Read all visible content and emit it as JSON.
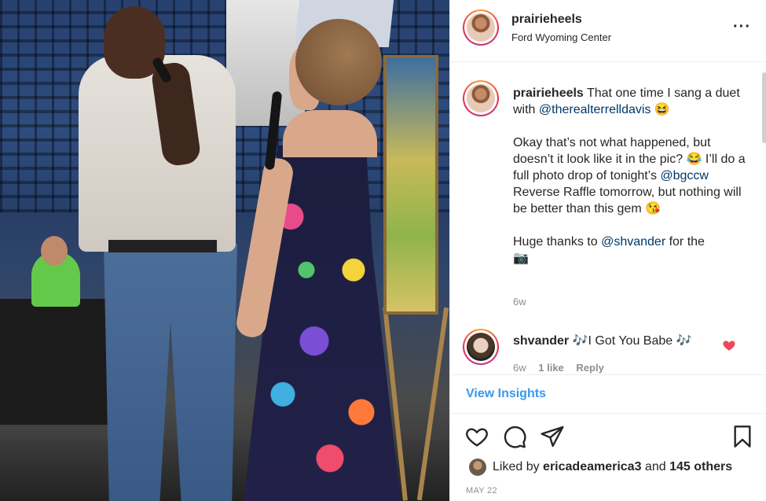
{
  "post": {
    "username": "prairieheels",
    "location": "Ford Wyoming Center",
    "more_icon": "more-horizontal-icon"
  },
  "caption": {
    "username": "prairieheels",
    "line1_text": " That one time I sang a duet with ",
    "mention1": "@therealterrelldavis",
    "emoji1": "😆",
    "para2_a": "Okay that’s not what happened, but doesn’t it look like it in the pic? ",
    "emoji2": "😂",
    "para2_b": " I’ll do a full photo drop of tonight’s ",
    "mention2": "@bgccw",
    "para2_c": " Reverse Raffle tomorrow, but nothing will be better than this gem ",
    "emoji3": "😘",
    "para3_a": "Huge thanks to ",
    "mention3": "@shvander",
    "para3_b": " for the",
    "emoji4": "📷",
    "time": "6w"
  },
  "comment": {
    "username": "shvander",
    "emoji_left": "🎶",
    "text": "I Got You Babe ",
    "emoji_right": "🎶",
    "time": "6w",
    "likes": "1 like",
    "reply": "Reply",
    "heart_color": "#ed4956"
  },
  "insights": {
    "label": "View Insights"
  },
  "actions": {
    "like_icon": "heart-outline-icon",
    "comment_icon": "comment-icon",
    "share_icon": "paper-plane-icon",
    "save_icon": "bookmark-icon"
  },
  "likes": {
    "prefix": "Liked by ",
    "user": "ericadeamerica3",
    "mid": " and ",
    "others": "145 others"
  },
  "date": "MAY 22",
  "colors": {
    "link_blue": "#3897f0",
    "mention_blue": "#00376b",
    "muted": "#8e8e8e",
    "text": "#262626"
  }
}
